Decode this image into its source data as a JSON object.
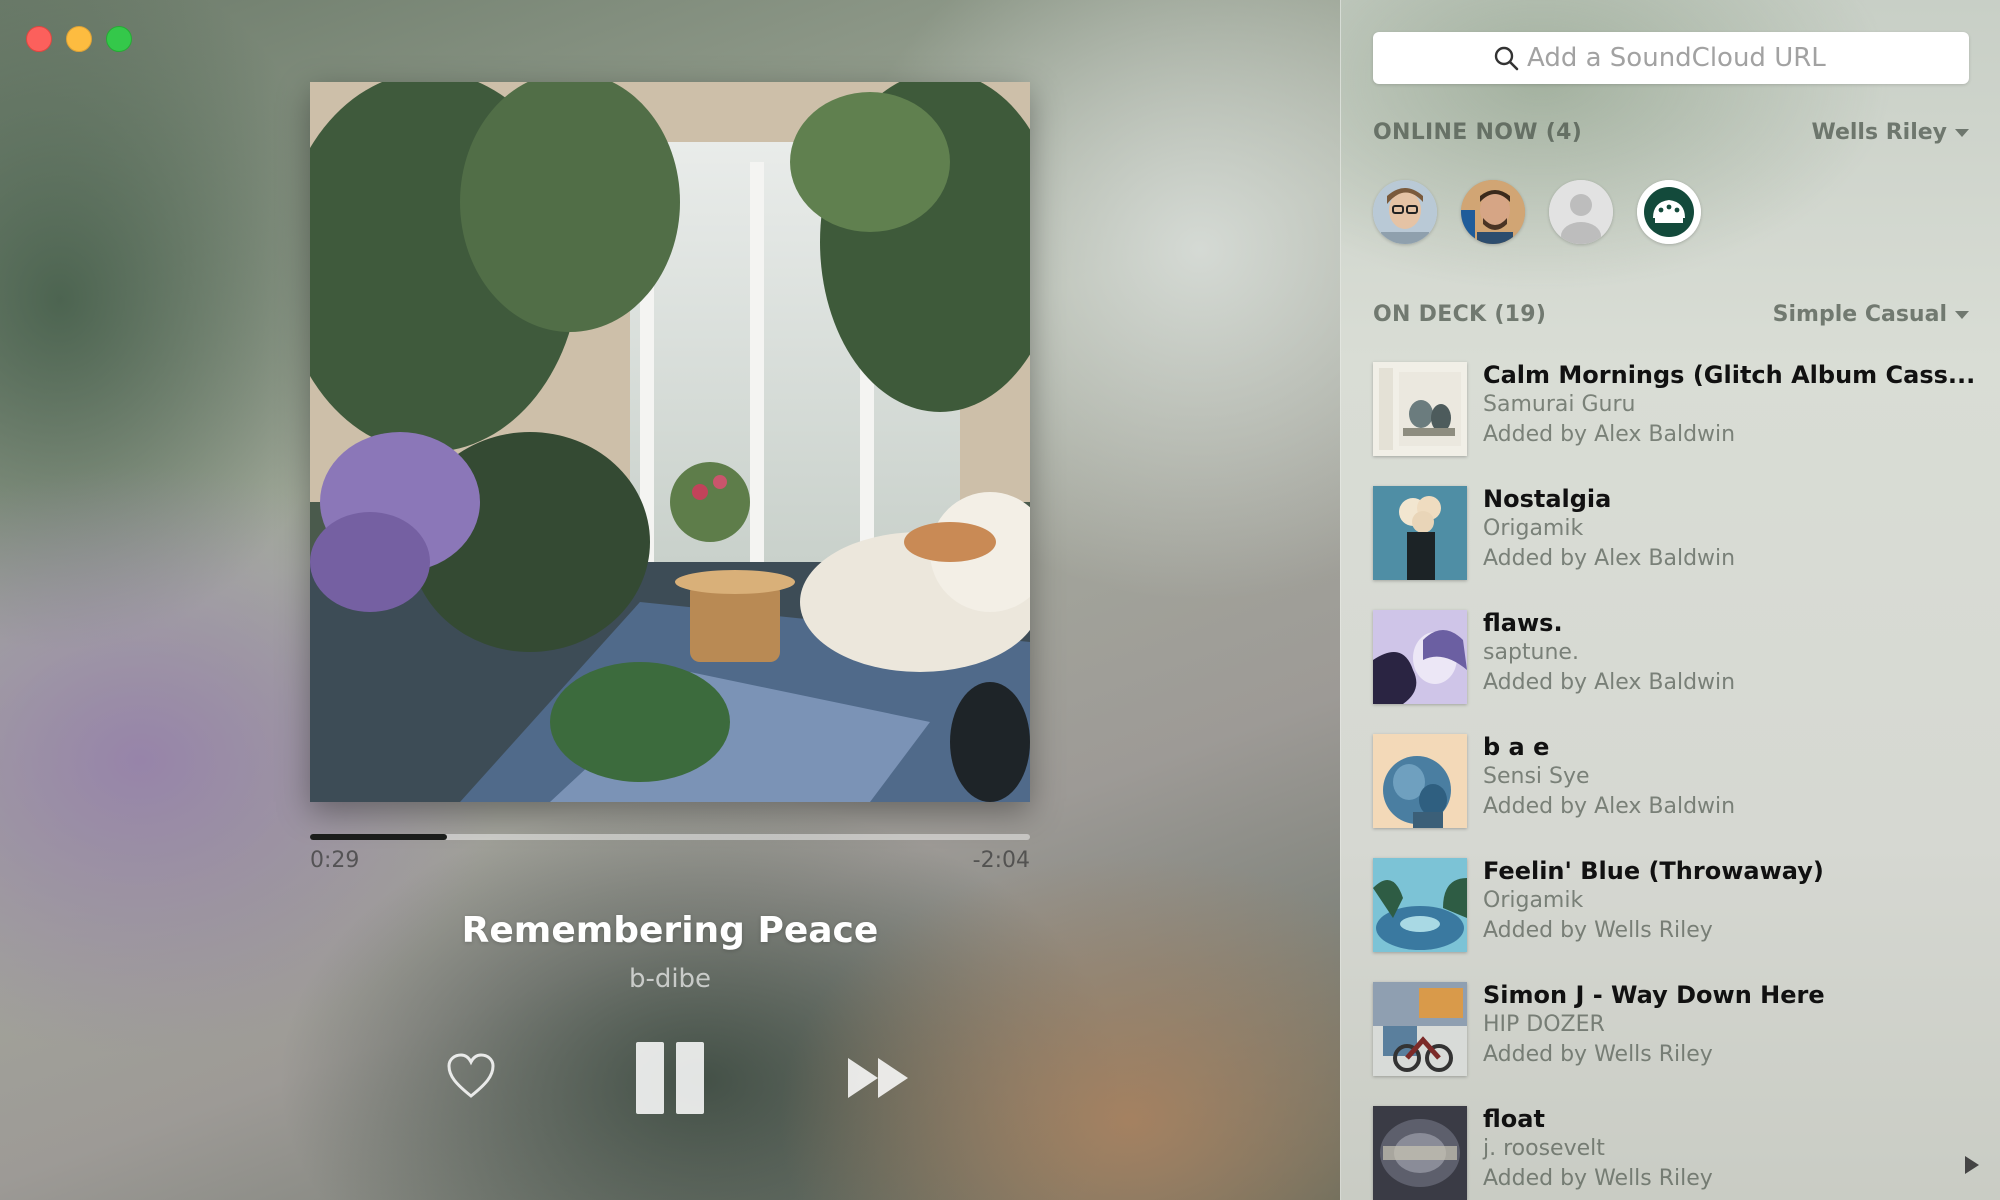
{
  "window": {
    "controls": [
      "close",
      "minimize",
      "maximize"
    ]
  },
  "player": {
    "elapsed": "0:29",
    "remaining": "-2:04",
    "progress": 0.19,
    "title": "Remembering Peace",
    "artist": "b-dibe",
    "controls": {
      "like_icon": "heart-icon",
      "pause_icon": "pause-icon",
      "next_icon": "fast-forward-icon"
    }
  },
  "sidebar": {
    "search": {
      "placeholder": "Add a SoundCloud URL",
      "icon": "search-icon"
    },
    "online": {
      "label": "ONLINE NOW (4)",
      "user": "Wells Riley",
      "avatars": [
        "avatar-user-1",
        "avatar-user-2",
        "avatar-default",
        "avatar-logo"
      ]
    },
    "deck": {
      "label": "ON DECK (19)",
      "playlist": "Simple Casual",
      "tracks": [
        {
          "title": "Calm Mornings (Glitch Album Cass...",
          "artist": "Samurai Guru",
          "added": "Added by Alex Baldwin"
        },
        {
          "title": "Nostalgia",
          "artist": "Origamik",
          "added": "Added by Alex Baldwin"
        },
        {
          "title": "flaws.",
          "artist": "saptune.",
          "added": "Added by Alex Baldwin"
        },
        {
          "title": "b a e",
          "artist": "Sensi Sye",
          "added": "Added by Alex Baldwin"
        },
        {
          "title": "Feelin' Blue (Throwaway)",
          "artist": "Origamik",
          "added": "Added by Wells Riley"
        },
        {
          "title": "Simon J - Way Down Here",
          "artist": "HIP DOZER",
          "added": "Added by Wells Riley"
        },
        {
          "title": "float",
          "artist": "j. roosevelt",
          "added": "Added by Wells Riley"
        }
      ]
    }
  }
}
